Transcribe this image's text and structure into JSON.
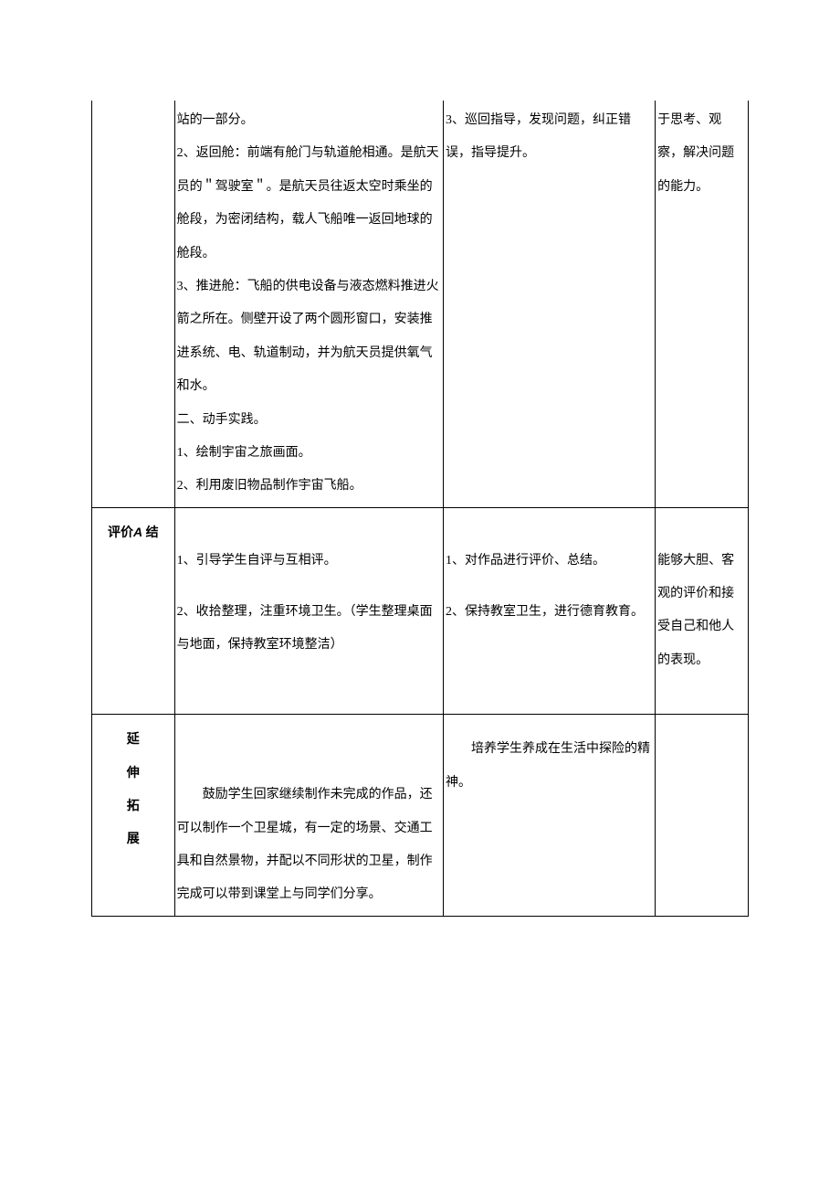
{
  "row1": {
    "col2": {
      "p1": "站的一部分。",
      "p2": "2、返回舱：前端有舱门与轨道舱相通。是航天员的＂驾驶室＂。是航天员往返太空时乘坐的舱段，为密闭结构，载人飞船唯一返回地球的舱段。",
      "p3": "3、推进舱：飞船的供电设备与液态燃料推进火箭之所在。侧壁开设了两个圆形窗口，安装推进系统、电、轨道制动，并为航天员提供氧气和水。",
      "p4": "二、动手实践。",
      "p5": "1、绘制宇宙之旅画面。",
      "p6": "2、利用废旧物品制作宇宙飞船。"
    },
    "col3": {
      "p1": "3、巡回指导，发现问题，纠正错误，指导提升。"
    },
    "col4": {
      "p1": "于思考、观察，解决问题的能力。"
    }
  },
  "row2": {
    "label_pre": "评价",
    "label_a": "A",
    "label_post": " 结",
    "col2": {
      "p1": "1、引导学生自评与互相评。",
      "p2": "2、收拾整理，注重环境卫生。（学生整理桌面与地面，保持教室环境整洁）"
    },
    "col3": {
      "p1": "1、对作品进行评价、总结。",
      "p2": "2、保持教室卫生，进行德育教育。"
    },
    "col4": {
      "p1": "能够大胆、客观的评价和接受自己和他人的表现。"
    }
  },
  "row3": {
    "label1": "延",
    "label2": "伸",
    "label3": "拓",
    "label4": "展",
    "col2": {
      "p1": "鼓励学生回家继续制作未完成的作品，还可以制作一个卫星城，有一定的场景、交通工具和自然景物，并配以不同形状的卫星，制作完成可以带到课堂上与同学们分享。"
    },
    "col3": {
      "p1": "培养学生养成在生活中探险的精神。"
    }
  }
}
